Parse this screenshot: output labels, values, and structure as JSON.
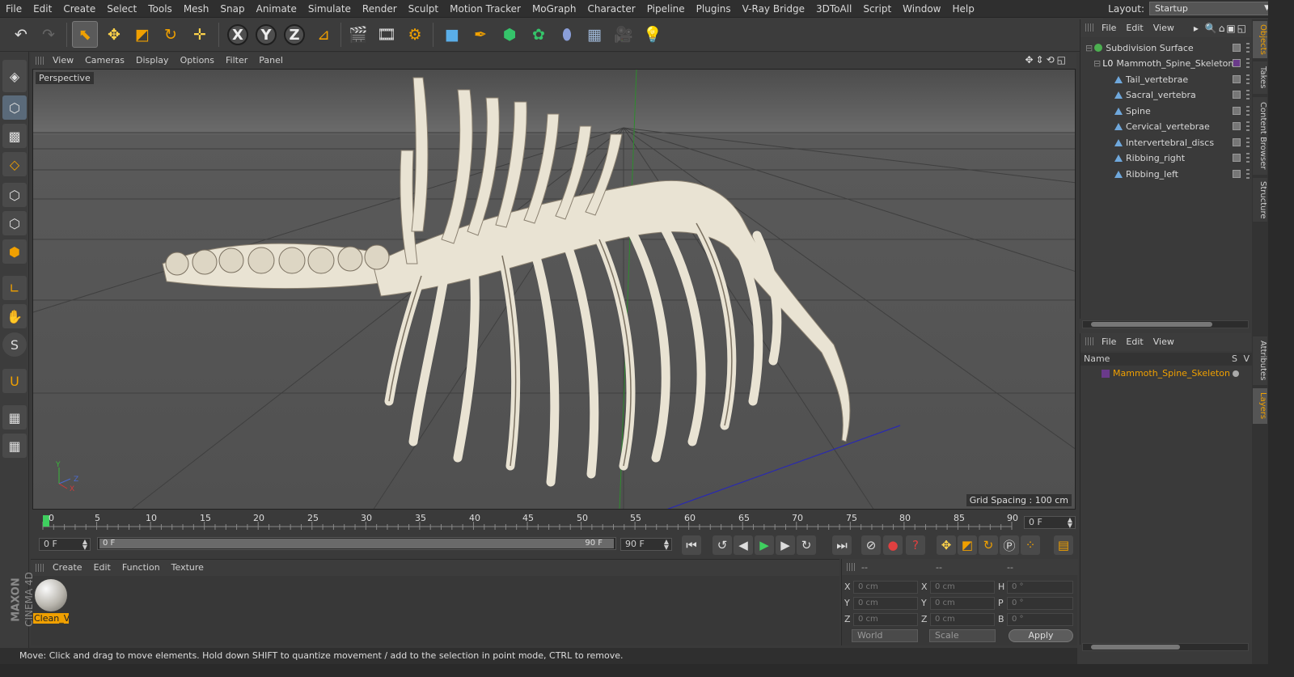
{
  "menubar": {
    "items": [
      "File",
      "Edit",
      "Create",
      "Select",
      "Tools",
      "Mesh",
      "Snap",
      "Animate",
      "Simulate",
      "Render",
      "Sculpt",
      "Motion Tracker",
      "MoGraph",
      "Character",
      "Pipeline",
      "Plugins",
      "V-Ray Bridge",
      "3DToAll",
      "Script",
      "Window",
      "Help"
    ],
    "layout_label": "Layout:",
    "layout_value": "Startup"
  },
  "toolbar": {
    "icons": [
      "undo-icon",
      "redo-icon",
      "select-arrow-icon",
      "move-icon",
      "scale-icon",
      "rotate-icon",
      "live-select-icon",
      "x-axis-icon",
      "y-axis-icon",
      "z-axis-icon",
      "coordinate-system-icon",
      "render-view-icon",
      "render-picture-viewer-icon",
      "render-settings-icon",
      "cube-icon",
      "pen-icon",
      "subdivision-icon",
      "cloner-icon",
      "deformer-icon",
      "floor-icon",
      "camera-icon",
      "light-icon"
    ],
    "axis_x": "X",
    "axis_y": "Y",
    "axis_z": "Z"
  },
  "viewport": {
    "menu": [
      "View",
      "Cameras",
      "Display",
      "Options",
      "Filter",
      "Panel"
    ],
    "label": "Perspective",
    "grid_spacing": "Grid Spacing : 100 cm",
    "axis_y": "Y",
    "axis_z": "Z",
    "axis_x": "X"
  },
  "timeline": {
    "ticks": [
      "0",
      "5",
      "10",
      "15",
      "20",
      "25",
      "30",
      "35",
      "40",
      "45",
      "50",
      "55",
      "60",
      "65",
      "70",
      "75",
      "80",
      "85",
      "90"
    ],
    "current_frame": "0 F",
    "start_field": "0 F",
    "range_left": "0 F",
    "range_right": "90 F",
    "end_field": "90 F"
  },
  "material_panel": {
    "menu": [
      "Create",
      "Edit",
      "Function",
      "Texture"
    ],
    "material_name": "Clean_V"
  },
  "coordinates": {
    "header": [
      "--",
      "--",
      "--"
    ],
    "rows": [
      {
        "l1": "X",
        "v1": "0 cm",
        "l2": "X",
        "v2": "0 cm",
        "l3": "H",
        "v3": "0 °"
      },
      {
        "l1": "Y",
        "v1": "0 cm",
        "l2": "Y",
        "v2": "0 cm",
        "l3": "P",
        "v3": "0 °"
      },
      {
        "l1": "Z",
        "v1": "0 cm",
        "l2": "Z",
        "v2": "0 cm",
        "l3": "B",
        "v3": "0 °"
      }
    ],
    "mode1": "World",
    "mode2": "Scale",
    "apply": "Apply"
  },
  "status": "Move: Click and drag to move elements. Hold down SHIFT to quantize movement / add to the selection in point mode, CTRL to remove.",
  "brand": {
    "line1": "MAXON",
    "line2": "CINEMA 4D"
  },
  "objects_panel": {
    "menu": [
      "File",
      "Edit",
      "View"
    ],
    "items": [
      {
        "name": "Subdivision Surface",
        "type": "subdivision",
        "level": 0
      },
      {
        "name": "Mammoth_Spine_Skeleton",
        "type": "null",
        "level": 1
      },
      {
        "name": "Tail_vertebrae",
        "type": "joint",
        "level": 2
      },
      {
        "name": "Sacral_vertebra",
        "type": "joint",
        "level": 2
      },
      {
        "name": "Spine",
        "type": "joint",
        "level": 2
      },
      {
        "name": "Cervical_vertebrae",
        "type": "joint",
        "level": 2
      },
      {
        "name": "Intervertebral_discs",
        "type": "joint",
        "level": 2
      },
      {
        "name": "Ribbing_right",
        "type": "joint",
        "level": 2
      },
      {
        "name": "Ribbing_left",
        "type": "joint",
        "level": 2
      }
    ]
  },
  "layers_panel": {
    "menu": [
      "File",
      "Edit",
      "View"
    ],
    "col_name": "Name",
    "col_s": "S",
    "col_v": "V",
    "layer": "Mammoth_Spine_Skeleton"
  },
  "side_tabs": [
    "Objects",
    "Takes",
    "Content Browser",
    "Structure",
    "Attributes",
    "Layers"
  ],
  "colors": {
    "accent": "#f0a000",
    "layer_color": "#6a3a8a",
    "joint": "#6fa8dc",
    "subdivision": "#4caf50"
  }
}
